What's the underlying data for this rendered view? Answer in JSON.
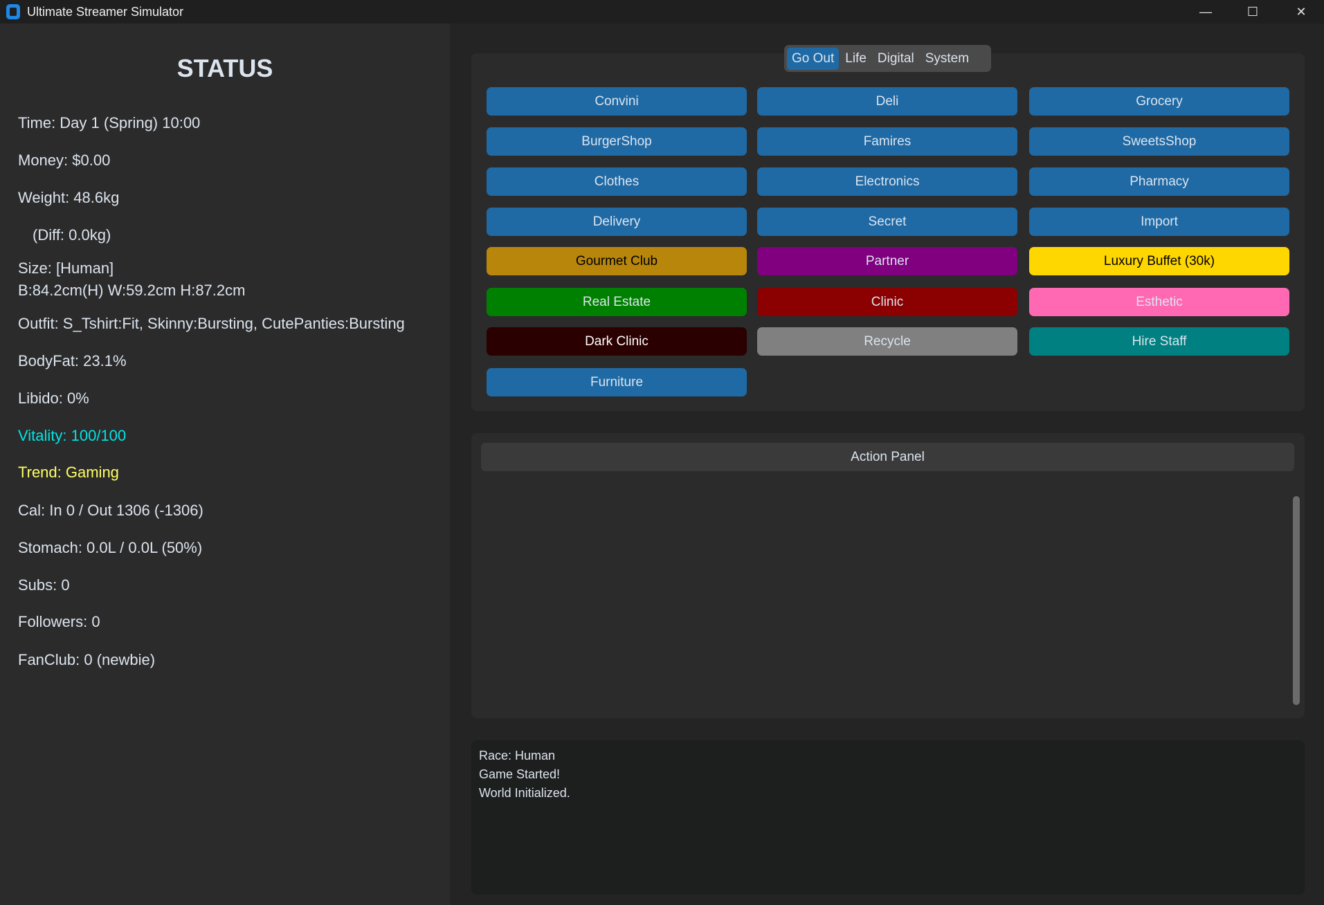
{
  "window": {
    "title": "Ultimate Streamer Simulator",
    "minimize": "—",
    "maximize": "☐",
    "close": "✕"
  },
  "status": {
    "heading": "STATUS",
    "time": "Time: Day 1 (Spring) 10:00",
    "money": "Money: $0.00",
    "weight": "Weight: 48.6kg",
    "diff": "(Diff: 0.0kg)",
    "size": "Size: [Human]",
    "measurements": "B:84.2cm(H) W:59.2cm H:87.2cm",
    "outfit": "Outfit: S_Tshirt:Fit, Skinny:Bursting, CutePanties:Bursting",
    "bodyfat": "BodyFat: 23.1%",
    "libido": "Libido: 0%",
    "vitality": "Vitality: 100/100",
    "trend": "Trend: Gaming",
    "cal": "Cal: In 0 / Out 1306 (-1306)",
    "stomach": "Stomach: 0.0L / 0.0L (50%)",
    "subs": "Subs: 0",
    "followers": "Followers: 0",
    "fanclub": "FanClub: 0 (newbie)"
  },
  "colors": {
    "vitality": "#00e5e5",
    "trend": "#ffff66"
  },
  "tabs": [
    "Go Out",
    "Life",
    "Digital",
    "System"
  ],
  "buttons": [
    {
      "label": "Convini",
      "bg": "#1f6aa5",
      "fg": "#dce4ee"
    },
    {
      "label": "Deli",
      "bg": "#1f6aa5",
      "fg": "#dce4ee"
    },
    {
      "label": "Grocery",
      "bg": "#1f6aa5",
      "fg": "#dce4ee"
    },
    {
      "label": "BurgerShop",
      "bg": "#1f6aa5",
      "fg": "#dce4ee"
    },
    {
      "label": "Famires",
      "bg": "#1f6aa5",
      "fg": "#dce4ee"
    },
    {
      "label": "SweetsShop",
      "bg": "#1f6aa5",
      "fg": "#dce4ee"
    },
    {
      "label": "Clothes",
      "bg": "#1f6aa5",
      "fg": "#dce4ee"
    },
    {
      "label": "Electronics",
      "bg": "#1f6aa5",
      "fg": "#dce4ee"
    },
    {
      "label": "Pharmacy",
      "bg": "#1f6aa5",
      "fg": "#dce4ee"
    },
    {
      "label": "Delivery",
      "bg": "#1f6aa5",
      "fg": "#dce4ee"
    },
    {
      "label": "Secret",
      "bg": "#1f6aa5",
      "fg": "#dce4ee"
    },
    {
      "label": "Import",
      "bg": "#1f6aa5",
      "fg": "#dce4ee"
    },
    {
      "label": "Gourmet Club",
      "bg": "#b8860b",
      "fg": "#000000"
    },
    {
      "label": "Partner",
      "bg": "#800080",
      "fg": "#dce4ee"
    },
    {
      "label": "Luxury Buffet (30k)",
      "bg": "#ffd700",
      "fg": "#000000"
    },
    {
      "label": "Real Estate",
      "bg": "#008000",
      "fg": "#dce4ee"
    },
    {
      "label": "Clinic",
      "bg": "#8b0000",
      "fg": "#dce4ee"
    },
    {
      "label": "Esthetic",
      "bg": "#ff69b4",
      "fg": "#dce4ee"
    },
    {
      "label": "Dark Clinic",
      "bg": "#2b0000",
      "fg": "#ffffff"
    },
    {
      "label": "Recycle",
      "bg": "#808080",
      "fg": "#dce4ee"
    },
    {
      "label": "Hire Staff",
      "bg": "#008080",
      "fg": "#dce4ee"
    },
    {
      "label": "Furniture",
      "bg": "#1f6aa5",
      "fg": "#dce4ee"
    }
  ],
  "action_panel": {
    "title": "Action Panel"
  },
  "log": [
    "Race: Human",
    "Game Started!",
    "World Initialized."
  ]
}
